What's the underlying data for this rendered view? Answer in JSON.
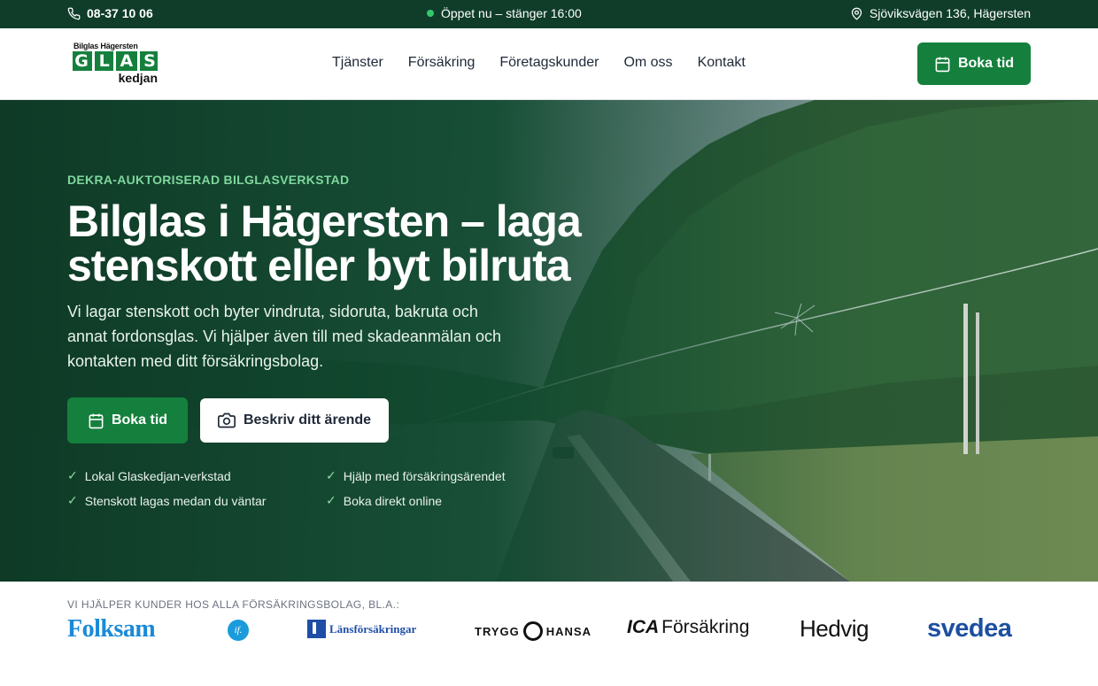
{
  "topbar": {
    "phone": "08-37 10 06",
    "status": "Öppet nu – stänger 16:00",
    "address": "Sjöviksvägen 136, Hägersten"
  },
  "logo": {
    "line1": "Bilglas Hägersten",
    "letters": [
      "G",
      "L",
      "A",
      "S"
    ],
    "line2": "kedjan"
  },
  "nav": {
    "items": [
      {
        "label": "Tjänster"
      },
      {
        "label": "Försäkring"
      },
      {
        "label": "Företagskunder"
      },
      {
        "label": "Om oss"
      },
      {
        "label": "Kontakt"
      }
    ],
    "cta": "Boka tid"
  },
  "hero": {
    "eyebrow": "DEKRA-AUKTORISERAD BILGLASVERKSTAD",
    "title": "Bilglas i Hägersten – laga stenskott eller byt bilruta",
    "lead": "Vi lagar stenskott och byter vindruta, sidoruta, bakruta och annat fordonsglas. Vi hjälper även till med skadeanmälan och kontakten med ditt försäkringsbolag.",
    "primary_button": "Boka tid",
    "secondary_button": "Beskriv ditt ärende",
    "features": [
      "Lokal Glaskedjan-verkstad",
      "Hjälp med försäkringsärendet",
      "Stenskott lagas medan du väntar",
      "Boka direkt online"
    ]
  },
  "partners": {
    "label": "VI HJÄLPER KUNDER HOS ALLA FÖRSÄKRINGSBOLAG, BL.A.:",
    "folksam": "Folksam",
    "if": "if.",
    "lansforsakringar": "Länsförsäkringar",
    "trygg": "TRYGG",
    "hansa": "HANSA",
    "ica_mark": "ICA",
    "ica_text": "Försäkring",
    "hedvig": "Hedvig",
    "svedea": "svedea"
  },
  "colors": {
    "topbar": "#0f3d2a",
    "accent": "#15803d",
    "eyebrow": "#7fd79c",
    "open_dot": "#34c76a"
  }
}
